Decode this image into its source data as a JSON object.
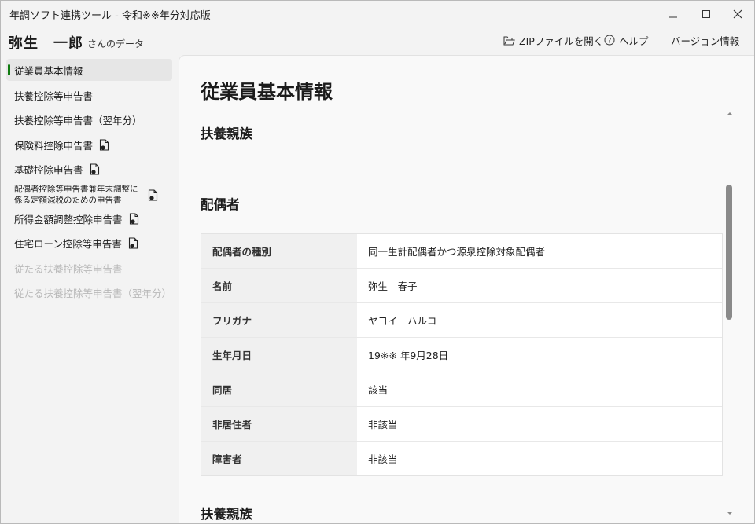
{
  "window": {
    "title": "年調ソフト連携ツール - 令和※※年分対応版"
  },
  "header": {
    "user_name": "弥生　一郎",
    "user_suffix": "さんのデータ",
    "toolbar": [
      {
        "label": "ZIPファイルを開く",
        "icon": "folder-open-icon"
      },
      {
        "label": "ヘルプ",
        "icon": "help-icon"
      },
      {
        "label": "バージョン情報",
        "icon": ""
      }
    ]
  },
  "sidebar": {
    "items": [
      {
        "label": "従業員基本情報",
        "active": true
      },
      {
        "label": "扶養控除等申告書"
      },
      {
        "label": "扶養控除等申告書（翌年分）"
      },
      {
        "label": "保険料控除申告書",
        "icon": "document-icon"
      },
      {
        "label": "基礎控除申告書",
        "icon": "document-icon"
      },
      {
        "label": "配偶者控除等申告書兼年末調整に係る定額減税のための申告書",
        "line1": "配偶者控除等申告書兼年末調整に",
        "line2": "係る定額減税のための申告書",
        "icon": "document-icon"
      },
      {
        "label": "所得金額調整控除申告書",
        "icon": "document-icon"
      },
      {
        "label": "住宅ローン控除等申告書",
        "icon": "document-icon"
      },
      {
        "label": "従たる扶養控除等申告書",
        "disabled": true
      },
      {
        "label": "従たる扶養控除等申告書（翌年分）",
        "disabled": true
      }
    ]
  },
  "main": {
    "page_title": "従業員基本情報",
    "section_dependents": "扶養親族",
    "section_spouse": "配偶者",
    "section_dependents_2": "扶養親族",
    "spouse_rows": [
      {
        "label": "配偶者の種別",
        "value": "同一生計配偶者かつ源泉控除対象配偶者"
      },
      {
        "label": "名前",
        "value": "弥生　春子"
      },
      {
        "label": "フリガナ",
        "value": "ヤヨイ　ハルコ"
      },
      {
        "label": "生年月日",
        "value": "19※※ 年9月28日"
      },
      {
        "label": "同居",
        "value": "該当"
      },
      {
        "label": "非居住者",
        "value": "非該当"
      },
      {
        "label": "障害者",
        "value": "非該当"
      }
    ]
  }
}
